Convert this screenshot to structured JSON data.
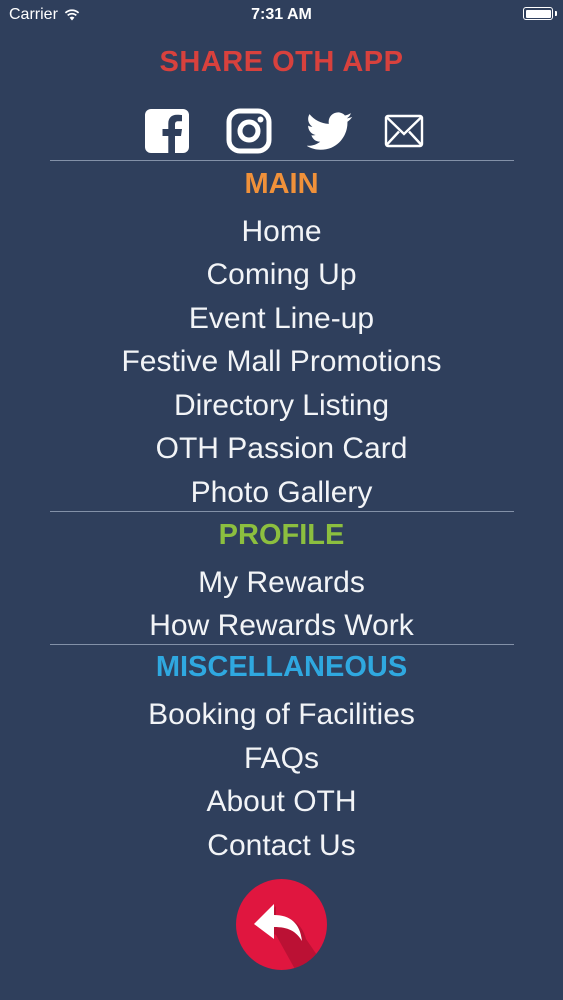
{
  "status_bar": {
    "carrier": "Carrier",
    "time": "7:31 AM"
  },
  "share": {
    "title": "SHARE OTH APP",
    "icons": [
      "facebook-icon",
      "instagram-icon",
      "twitter-icon",
      "mail-icon"
    ]
  },
  "sections": {
    "main": {
      "title": "MAIN",
      "color": "#f0913a",
      "items": [
        "Home",
        "Coming Up",
        "Event Line-up",
        "Festive Mall Promotions",
        "Directory Listing",
        "OTH Passion Card",
        "Photo Gallery"
      ]
    },
    "profile": {
      "title": "PROFILE",
      "color": "#8cbf3f",
      "items": [
        "My Rewards",
        "How Rewards Work"
      ]
    },
    "misc": {
      "title": "MISCELLANEOUS",
      "color": "#2fa8e0",
      "items": [
        "Booking of Facilities",
        "FAQs",
        "About OTH",
        "Contact Us"
      ]
    }
  },
  "colors": {
    "background": "#2f3f5c",
    "share_title": "#d8413d",
    "back_button": "#e0163f"
  },
  "back_button": {
    "icon": "reply-arrow-icon"
  }
}
